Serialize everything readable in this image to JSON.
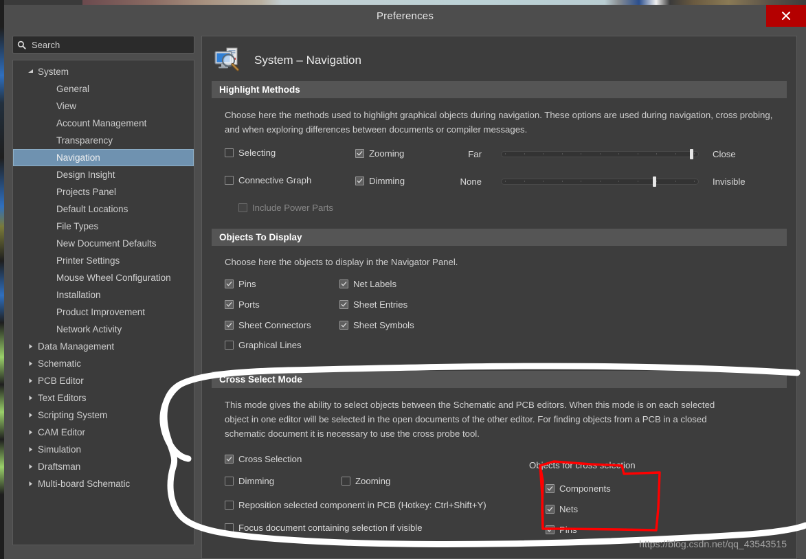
{
  "window": {
    "title": "Preferences",
    "close_label": "×"
  },
  "search": {
    "placeholder": "Search",
    "value": "",
    "icon": "search-icon"
  },
  "sidebar": {
    "items": [
      {
        "label": "System",
        "level": 0,
        "expanded": true,
        "selected": false
      },
      {
        "label": "General",
        "level": 1,
        "selected": false
      },
      {
        "label": "View",
        "level": 1,
        "selected": false
      },
      {
        "label": "Account Management",
        "level": 1,
        "selected": false
      },
      {
        "label": "Transparency",
        "level": 1,
        "selected": false
      },
      {
        "label": "Navigation",
        "level": 1,
        "selected": true
      },
      {
        "label": "Design Insight",
        "level": 1,
        "selected": false
      },
      {
        "label": "Projects Panel",
        "level": 1,
        "selected": false
      },
      {
        "label": "Default Locations",
        "level": 1,
        "selected": false
      },
      {
        "label": "File Types",
        "level": 1,
        "selected": false
      },
      {
        "label": "New Document Defaults",
        "level": 1,
        "selected": false
      },
      {
        "label": "Printer Settings",
        "level": 1,
        "selected": false
      },
      {
        "label": "Mouse Wheel Configuration",
        "level": 1,
        "selected": false
      },
      {
        "label": "Installation",
        "level": 1,
        "selected": false
      },
      {
        "label": "Product Improvement",
        "level": 1,
        "selected": false
      },
      {
        "label": "Network Activity",
        "level": 1,
        "selected": false
      },
      {
        "label": "Data Management",
        "level": 0,
        "expanded": false,
        "selected": false
      },
      {
        "label": "Schematic",
        "level": 0,
        "expanded": false,
        "selected": false
      },
      {
        "label": "PCB Editor",
        "level": 0,
        "expanded": false,
        "selected": false
      },
      {
        "label": "Text Editors",
        "level": 0,
        "expanded": false,
        "selected": false
      },
      {
        "label": "Scripting System",
        "level": 0,
        "expanded": false,
        "selected": false
      },
      {
        "label": "CAM Editor",
        "level": 0,
        "expanded": false,
        "selected": false
      },
      {
        "label": "Simulation",
        "level": 0,
        "expanded": false,
        "selected": false
      },
      {
        "label": "Draftsman",
        "level": 0,
        "expanded": false,
        "selected": false
      },
      {
        "label": "Multi-board Schematic",
        "level": 0,
        "expanded": false,
        "selected": false
      }
    ]
  },
  "page": {
    "title": "System – Navigation",
    "icon": "monitor-magnifier-icon"
  },
  "highlight_methods": {
    "header": "Highlight Methods",
    "description": "Choose here the methods used to highlight graphical objects during navigation. These options are used during navigation, cross probing, and when exploring differences between documents or compiler messages.",
    "selecting": {
      "label": "Selecting",
      "checked": false
    },
    "zooming": {
      "label": "Zooming",
      "checked": true
    },
    "connective_graph": {
      "label": "Connective Graph",
      "checked": false
    },
    "dimming": {
      "label": "Dimming",
      "checked": true
    },
    "include_power_parts": {
      "label": "Include Power Parts",
      "checked": false,
      "disabled": true
    },
    "zoom_slider": {
      "left_label": "Far",
      "right_label": "Close",
      "value_pct": 97
    },
    "dim_slider": {
      "left_label": "None",
      "right_label": "Invisible",
      "value_pct": 78
    }
  },
  "objects_to_display": {
    "header": "Objects To Display",
    "description": "Choose here the objects to display in the Navigator Panel.",
    "items_left": [
      {
        "label": "Pins",
        "checked": true
      },
      {
        "label": "Ports",
        "checked": true
      },
      {
        "label": "Sheet Connectors",
        "checked": true
      },
      {
        "label": "Graphical Lines",
        "checked": false
      }
    ],
    "items_right": [
      {
        "label": "Net Labels",
        "checked": true
      },
      {
        "label": "Sheet Entries",
        "checked": true
      },
      {
        "label": "Sheet Symbols",
        "checked": true
      }
    ]
  },
  "cross_select_mode": {
    "header": "Cross Select Mode",
    "description": "This mode gives the ability to select objects between the Schematic and PCB editors.  When this mode is on each selected object in one editor will be selected in the open documents of the other editor.  For finding objects from a PCB in a closed schematic document it is necessary to use the cross probe tool.",
    "cross_selection": {
      "label": "Cross Selection",
      "checked": true
    },
    "dimming": {
      "label": "Dimming",
      "checked": false
    },
    "zooming": {
      "label": "Zooming",
      "checked": false
    },
    "reposition": {
      "label": "Reposition selected component in PCB (Hotkey: Ctrl+Shift+Y)",
      "checked": false
    },
    "focus_document": {
      "label": "Focus document containing selection if visible",
      "checked": false
    },
    "objects_group_label": "Objects for cross selection",
    "objects": [
      {
        "label": "Components",
        "checked": true
      },
      {
        "label": "Nets",
        "checked": true
      },
      {
        "label": "Pins",
        "checked": true
      }
    ]
  },
  "annotations": {
    "watermark": "https://blog.csdn.net/qq_43543515",
    "highlight_color": "#ffffff",
    "box_color": "#ff0000"
  }
}
